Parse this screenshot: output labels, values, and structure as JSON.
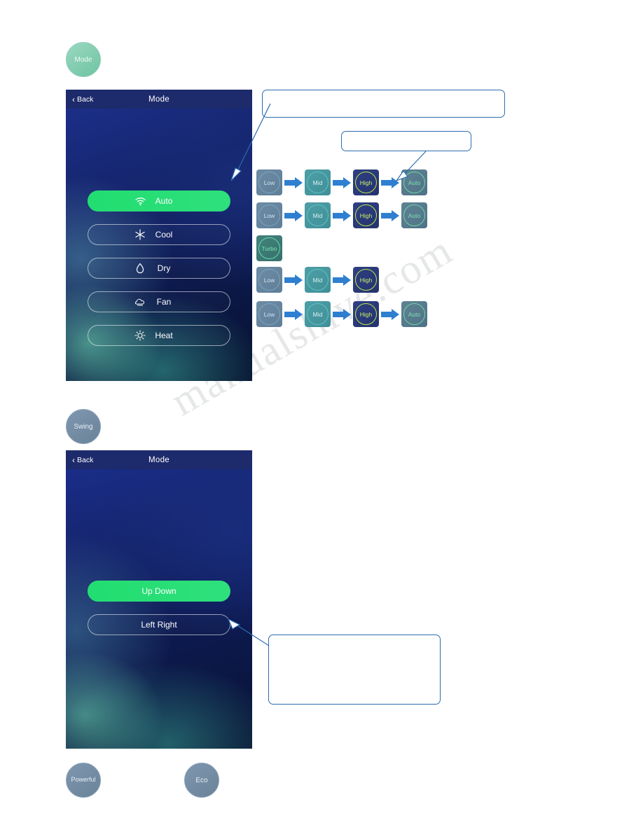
{
  "watermark": {
    "text": "manualshive.com"
  },
  "chips": {
    "mode": {
      "label": "Mode"
    },
    "swing": {
      "label": "Swing"
    },
    "powerful": {
      "label": "Powerful"
    },
    "eco": {
      "label": "Eco"
    }
  },
  "phone_mode": {
    "back_label": "Back",
    "title": "Mode",
    "options": [
      {
        "label": "Auto",
        "icon": "wifi-icon",
        "active": true
      },
      {
        "label": "Cool",
        "icon": "snowflake-icon",
        "active": false
      },
      {
        "label": "Dry",
        "icon": "droplet-icon",
        "active": false
      },
      {
        "label": "Fan",
        "icon": "fan-cloud-icon",
        "active": false
      },
      {
        "label": "Heat",
        "icon": "sun-icon",
        "active": false
      }
    ]
  },
  "phone_swing": {
    "back_label": "Back",
    "title": "Mode",
    "options": [
      {
        "label": "Up Down",
        "active": true
      },
      {
        "label": "Left Right",
        "active": false
      }
    ]
  },
  "fan_rows": [
    {
      "steps": [
        "Low",
        "Mid",
        "High",
        "Auto"
      ],
      "styles": [
        "low",
        "mid",
        "high",
        "auto"
      ]
    },
    {
      "steps": [
        "Low",
        "Mid",
        "High",
        "Auto"
      ],
      "styles": [
        "low",
        "mid",
        "high",
        "auto"
      ]
    },
    {
      "steps": [
        "Turbo"
      ],
      "styles": [
        "turbo"
      ]
    },
    {
      "steps": [
        "Low",
        "Mid",
        "High"
      ],
      "styles": [
        "low",
        "mid",
        "high"
      ]
    },
    {
      "steps": [
        "Low",
        "Mid",
        "High",
        "Auto"
      ],
      "styles": [
        "low",
        "mid",
        "high",
        "auto"
      ]
    }
  ],
  "callouts": {
    "top": {
      "text": ""
    },
    "middle": {
      "text": ""
    },
    "bottom": {
      "text": ""
    }
  },
  "colors": {
    "accent_green": "#21dd70",
    "callout_border": "#2b6cb0",
    "arrow_blue": "#2f7fd1",
    "phone_bar": "#1d2a6b"
  }
}
